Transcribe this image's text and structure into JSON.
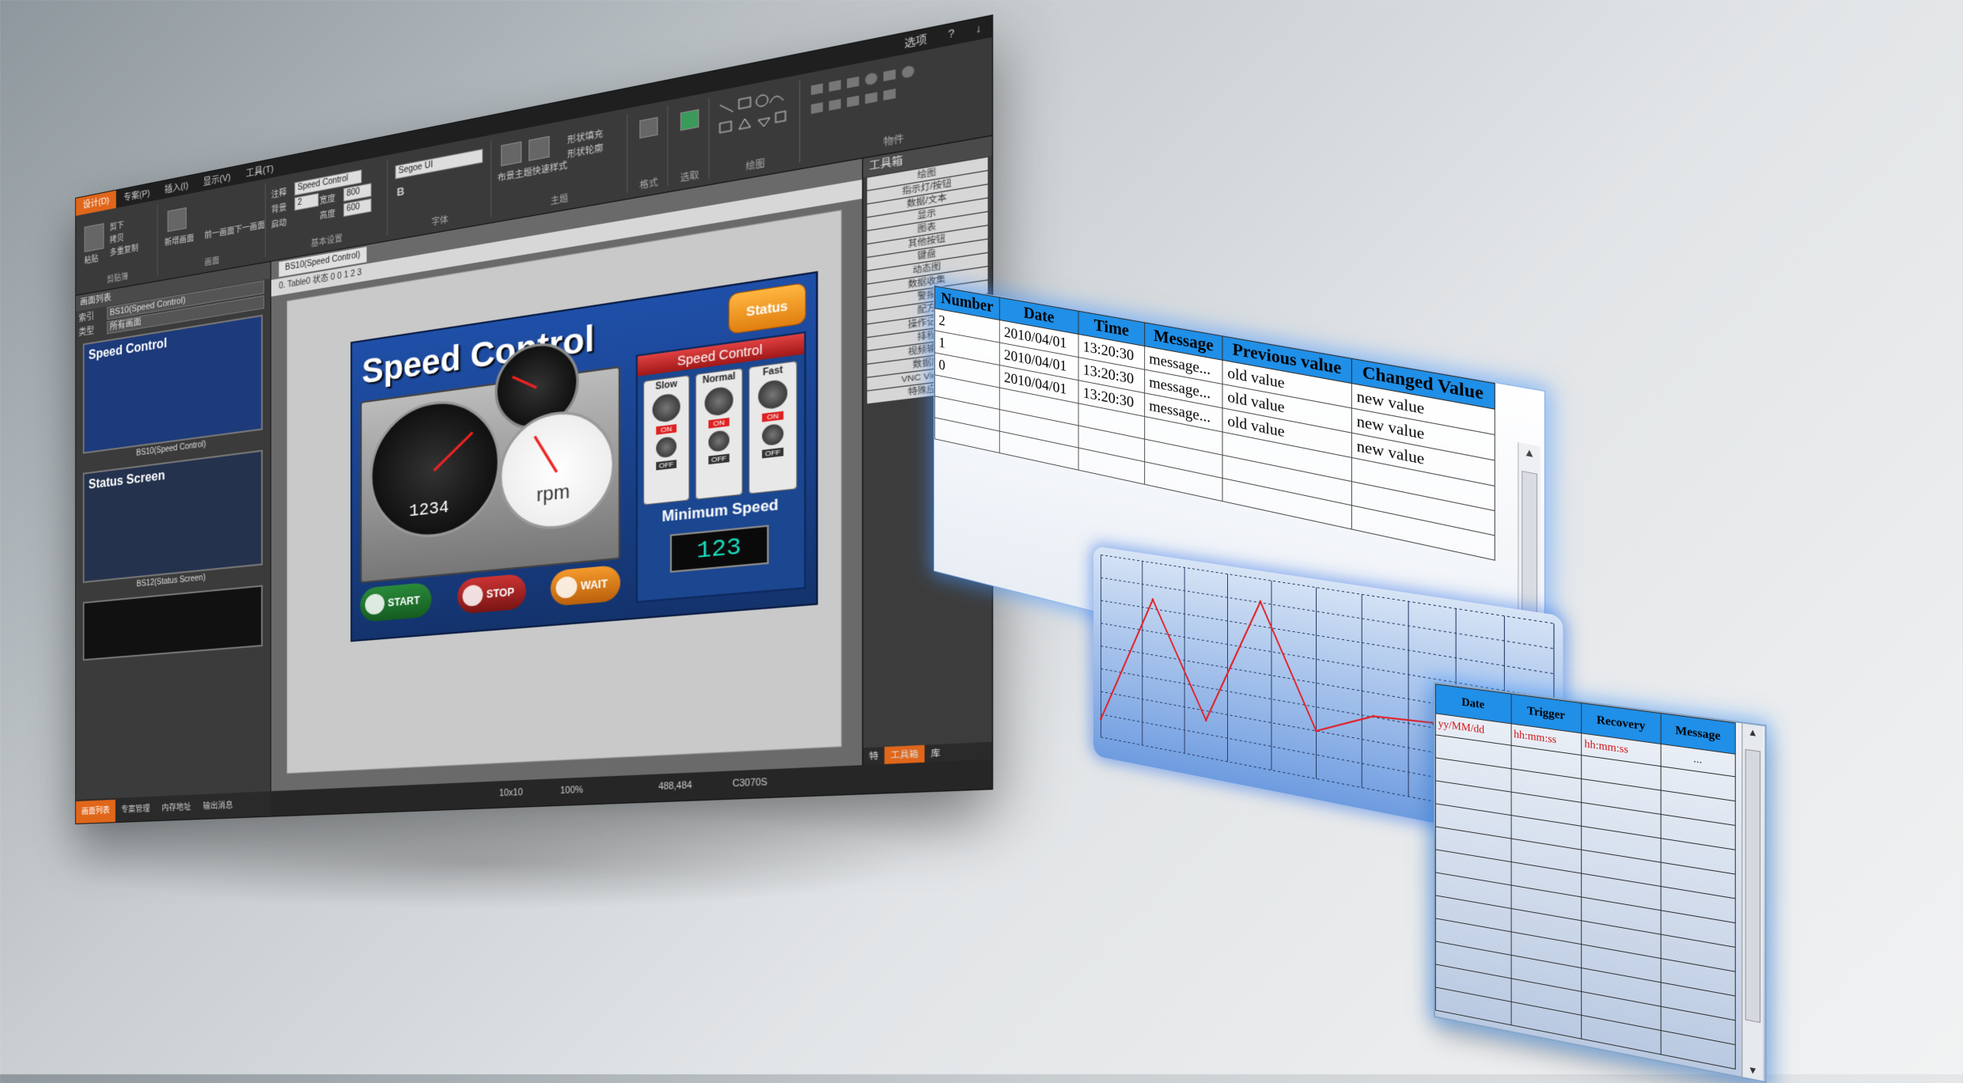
{
  "editor": {
    "top_right": [
      "选项",
      "?",
      "↓"
    ],
    "menus": [
      "设计(D)",
      "专案(P)",
      "插入(I)",
      "显示(V)",
      "工具(T)"
    ],
    "ribbon": {
      "clipboard": {
        "label": "剪贴簿",
        "items": [
          "粘贴",
          "剪下",
          "拷贝",
          "多重复制"
        ]
      },
      "screens": {
        "label": "画面",
        "items": [
          "新增画面",
          "前一画面",
          "下一画面"
        ]
      },
      "basic": {
        "label": "基本设置",
        "comment": "注释",
        "comment_value": "Speed Control",
        "screen_no": "2",
        "width_label": "宽度",
        "width": "800",
        "height_label": "高度",
        "height": "600",
        "bg_label": "背景",
        "startup_label": "启动"
      },
      "font": {
        "label": "字体",
        "font_name": "Segoe UI",
        "bold": "B"
      },
      "theme": {
        "label": "主题",
        "items": [
          "布景主题",
          "快速样式",
          "形状填充",
          "形状轮廓"
        ]
      },
      "format": {
        "label": "格式"
      },
      "select": {
        "label": "选取"
      },
      "draw": {
        "label": "绘图"
      },
      "objects": {
        "label": "物件"
      }
    },
    "left_panel": {
      "title": "画面列表",
      "fields": [
        {
          "label": "索引",
          "value": "BS10(Speed Control)"
        },
        {
          "label": "类型",
          "value": "所有画面"
        }
      ],
      "thumbs": [
        {
          "title": "Speed Control",
          "caption": "BS10(Speed Control)"
        },
        {
          "title": "Status Screen",
          "caption": "BS12(Status Screen)"
        }
      ],
      "bottom_tabs": [
        "画面列表",
        "专案管理",
        "内存地址",
        "输出消息"
      ]
    },
    "doc": {
      "tab": "BS10(Speed Control)",
      "toolbar": "0. Table0     状态 0     0  1  2  3"
    },
    "hmi": {
      "title": "Speed Control",
      "status_button": "Status",
      "control_header": "Speed Control",
      "knobs": [
        {
          "label": "Slow"
        },
        {
          "label": "Normal"
        },
        {
          "label": "Fast"
        }
      ],
      "on": "ON",
      "off": "OFF",
      "gauge_value": "1234",
      "gauge_unit": "rpm",
      "min_speed_label": "Minimum Speed",
      "min_speed_value": "123",
      "buttons": [
        "START",
        "STOP",
        "WAIT"
      ]
    },
    "right_panel": {
      "title": "工具箱",
      "items": [
        "绘图",
        "指示灯/按钮",
        "数据/文本",
        "显示",
        "图表",
        "其他按钮",
        "键盘",
        "动态图",
        "数据收集",
        "警报",
        "配方",
        "操作记录",
        "排程",
        "视频输入",
        "数据库",
        "VNC Viewer",
        "特殊应用"
      ],
      "tabs": [
        "特",
        "工具箱",
        "库"
      ]
    },
    "status": {
      "grid": "10x10",
      "zoom": "100%",
      "coords": "488,484",
      "info": "C3070S"
    }
  },
  "event_table": {
    "columns": [
      "Number",
      "Date",
      "Time",
      "Message",
      "Previous value",
      "Changed Value"
    ],
    "rows": [
      [
        "2",
        "2010/04/01",
        "13:20:30",
        "message...",
        "old value",
        "new value"
      ],
      [
        "1",
        "2010/04/01",
        "13:20:30",
        "message...",
        "old value",
        "new value"
      ],
      [
        "0",
        "2010/04/01",
        "13:20:30",
        "message...",
        "old value",
        "new value"
      ]
    ]
  },
  "chart_data": {
    "type": "line",
    "title": "",
    "xlabel": "",
    "ylabel": "",
    "x": [
      0,
      1,
      2,
      3,
      4,
      5,
      6,
      7,
      8
    ],
    "series": [
      {
        "values": [
          10,
          80,
          20,
          88,
          25,
          38,
          40,
          10,
          20
        ]
      }
    ],
    "ylim": [
      0,
      100
    ],
    "grid": true,
    "line_color": "#e0232a"
  },
  "alarm_table": {
    "columns": [
      "Date",
      "Trigger",
      "Recovery",
      "Message"
    ],
    "row": [
      "yy/MM/dd",
      "hh:mm:ss",
      "hh:mm:ss",
      "..."
    ],
    "empty_rows": 12
  },
  "colors": {
    "accent": "#e0661a",
    "hmi_blue": "#1f4fa8",
    "table_header": "#1f8fe8",
    "alarm_text": "#d01010",
    "glow": "#4696ff"
  }
}
